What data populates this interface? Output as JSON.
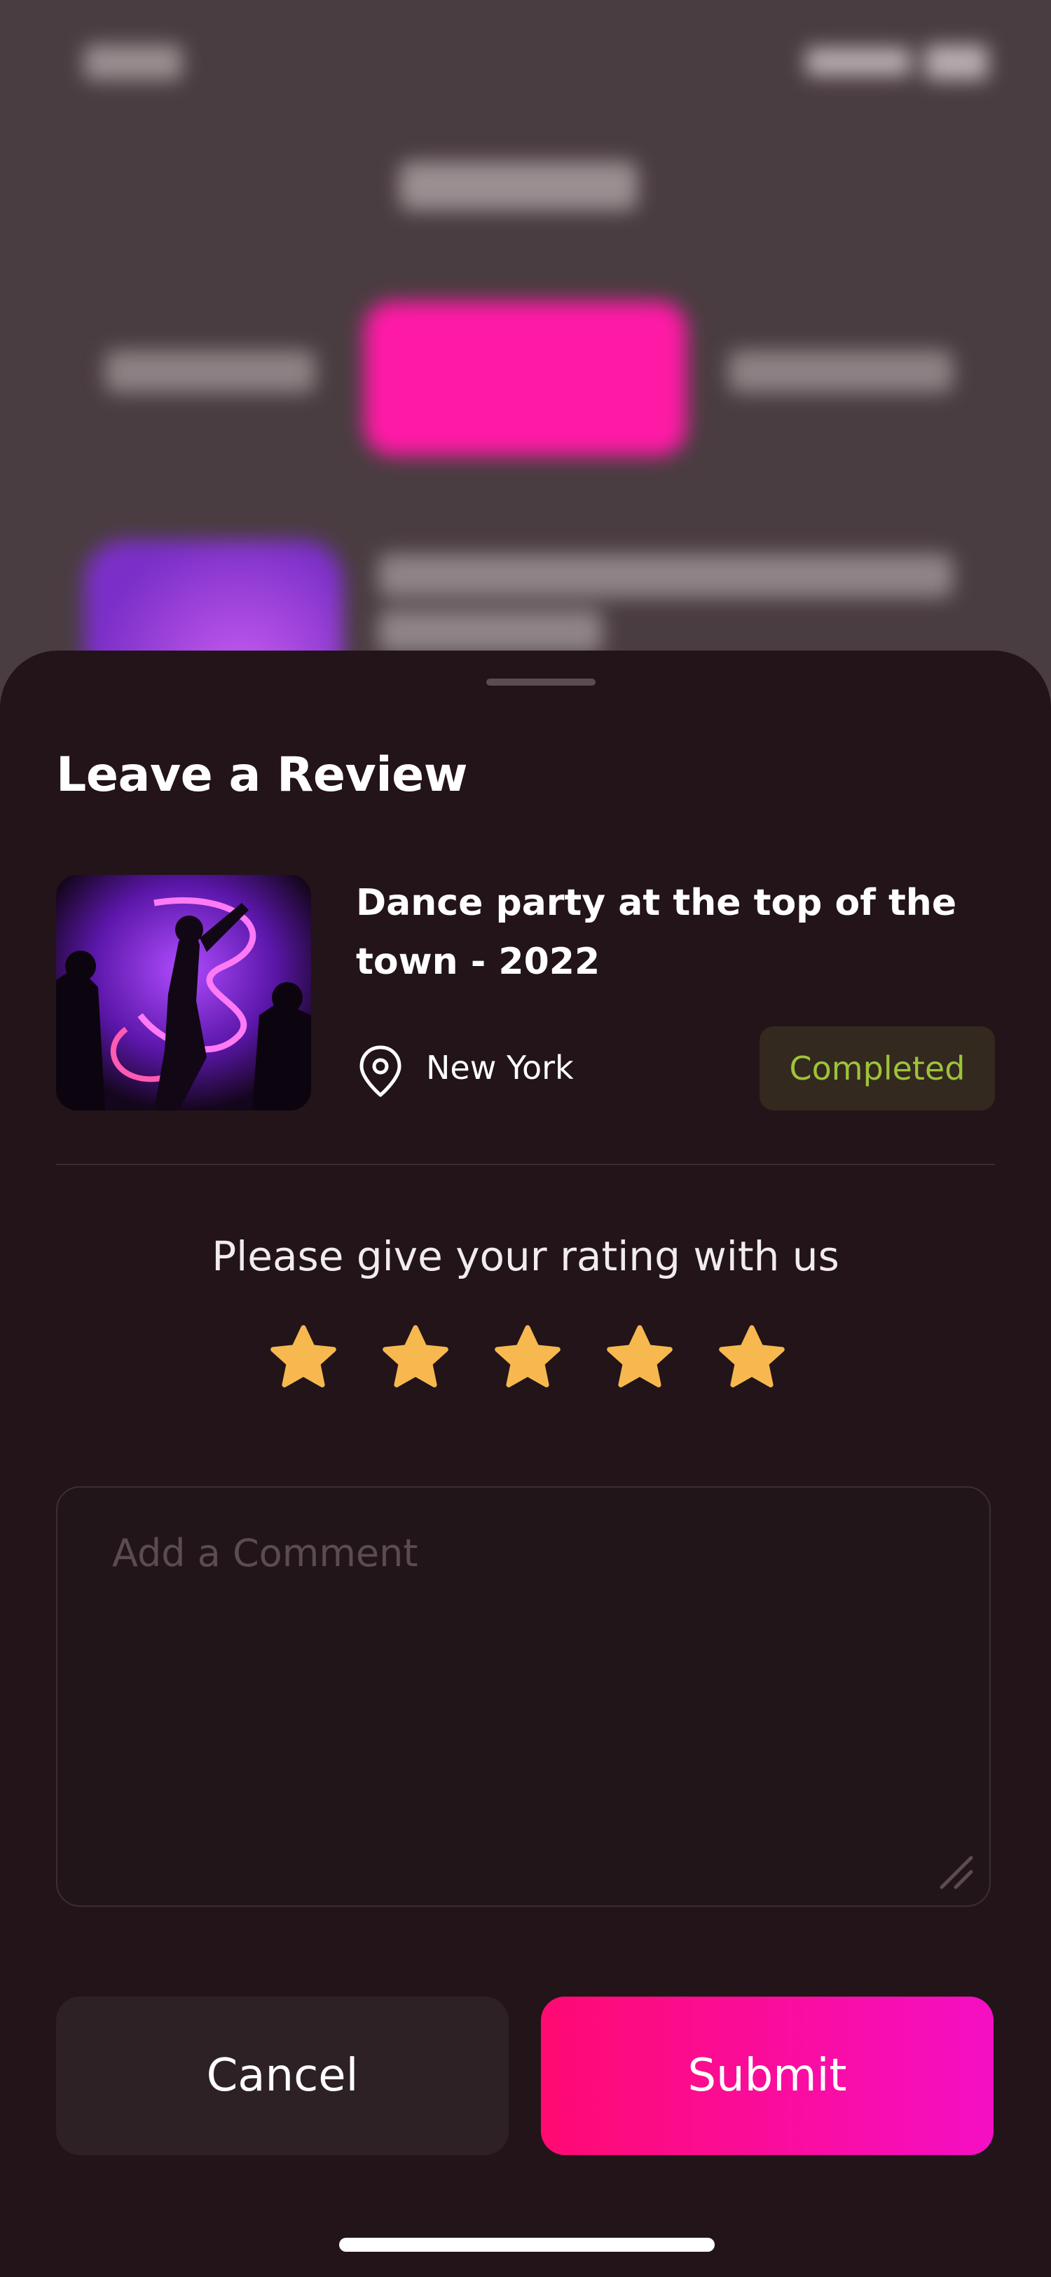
{
  "sheet": {
    "title": "Leave a Review",
    "event": {
      "title": "Dance party at the top of the town - 2022",
      "location": "New York",
      "status": "Completed",
      "image_icon": "neon-party-image"
    },
    "rating": {
      "prompt": "Please give your rating with us",
      "stars_filled": 5,
      "stars_total": 5,
      "star_color": "#F6B84F"
    },
    "comment": {
      "placeholder": "Add a Comment",
      "value": ""
    },
    "actions": {
      "cancel_label": "Cancel",
      "submit_label": "Submit"
    }
  },
  "colors": {
    "sheet_background": "#221419",
    "accent": "#FF0A72",
    "status_text": "#9EC33A"
  }
}
